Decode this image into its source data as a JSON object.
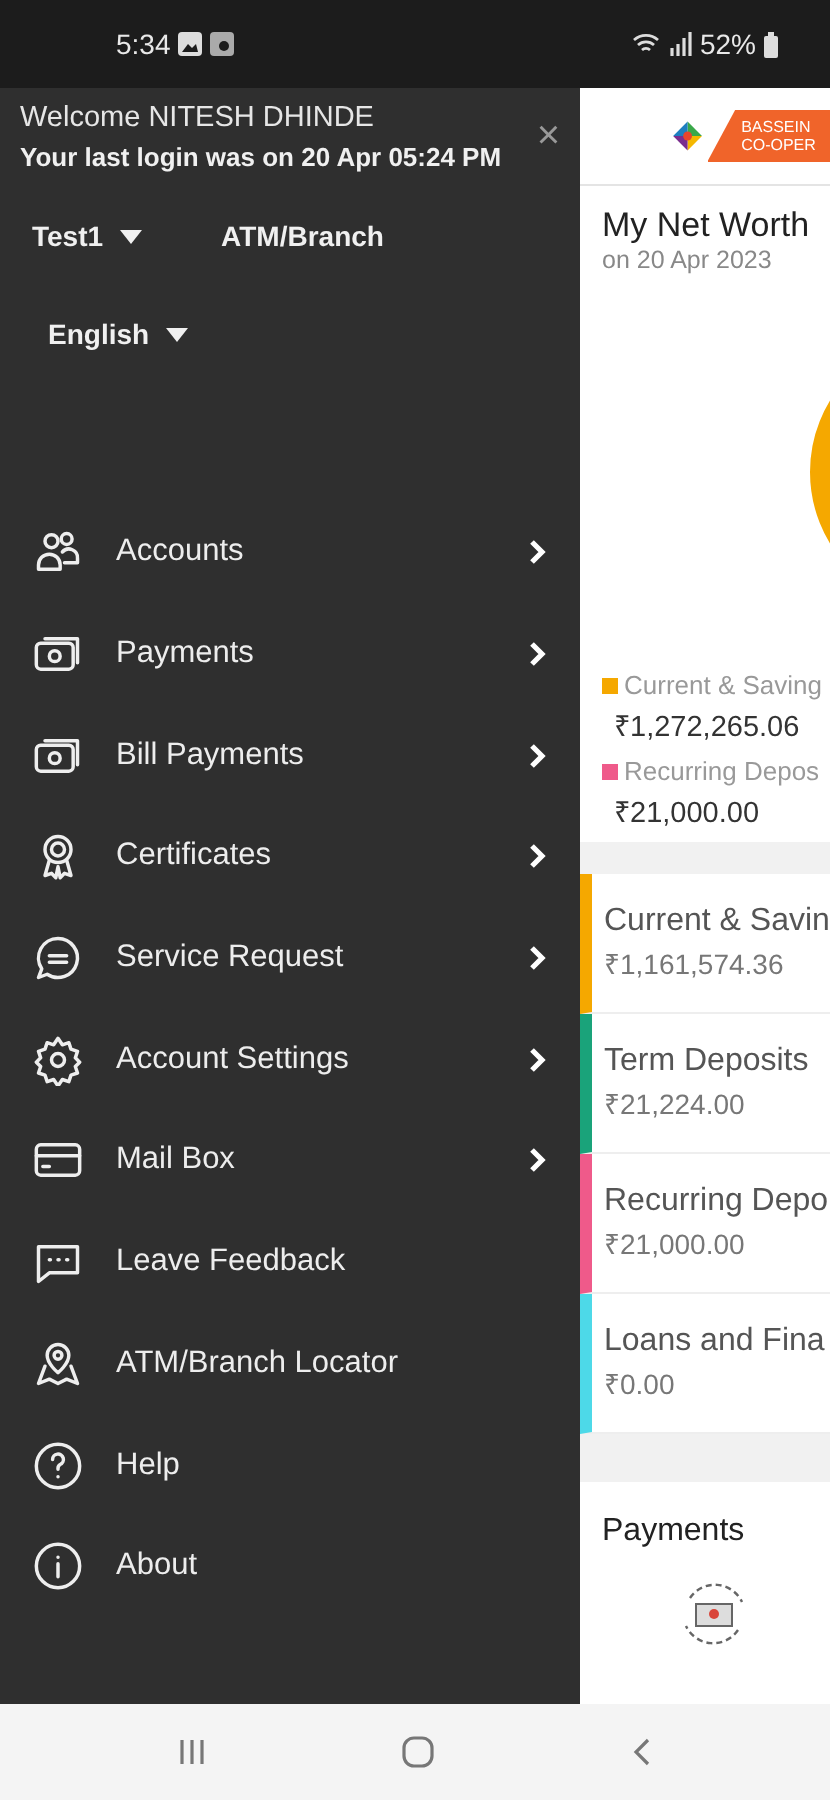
{
  "status_bar": {
    "time": "5:34",
    "battery": "52%"
  },
  "drawer": {
    "welcome": "Welcome NITESH DHINDE",
    "last_login": "Your last login was on 20 Apr 05:24 PM",
    "close": "×",
    "account_selector": "Test1",
    "atm_branch": "ATM/Branch",
    "language": "English",
    "items": [
      {
        "label": "Accounts",
        "submenu": true
      },
      {
        "label": "Payments",
        "submenu": true
      },
      {
        "label": "Bill Payments",
        "submenu": true
      },
      {
        "label": "Certificates",
        "submenu": true
      },
      {
        "label": "Service Request",
        "submenu": true
      },
      {
        "label": "Account Settings",
        "submenu": true
      },
      {
        "label": "Mail Box",
        "submenu": true
      },
      {
        "label": "Leave Feedback",
        "submenu": false
      },
      {
        "label": "ATM/Branch Locator",
        "submenu": false
      },
      {
        "label": "Help",
        "submenu": false
      },
      {
        "label": "About",
        "submenu": false
      }
    ]
  },
  "main": {
    "logo_text": [
      "BASSEIN",
      "CO-OPER"
    ],
    "net_worth": {
      "title": "My Net Worth",
      "date": "on 20 Apr 2023",
      "legend": [
        {
          "label": "Current & Saving",
          "amount": "₹1,272,265.06",
          "color": "#f5a800"
        },
        {
          "label": "Recurring Depos",
          "amount": "₹21,000.00",
          "color": "#ef5a8a"
        }
      ]
    },
    "accounts": [
      {
        "label": "Current & Savin",
        "amount": "₹1,161,574.36",
        "color": "#f5a800"
      },
      {
        "label": "Term Deposits",
        "amount": "₹21,224.00",
        "color": "#1aa37a"
      },
      {
        "label": "Recurring Depo",
        "amount": "₹21,000.00",
        "color": "#ef5a8a"
      },
      {
        "label": "Loans and Fina",
        "amount": "₹0.00",
        "color": "#4dd9e8"
      }
    ],
    "payments": {
      "title": "Payments"
    }
  }
}
